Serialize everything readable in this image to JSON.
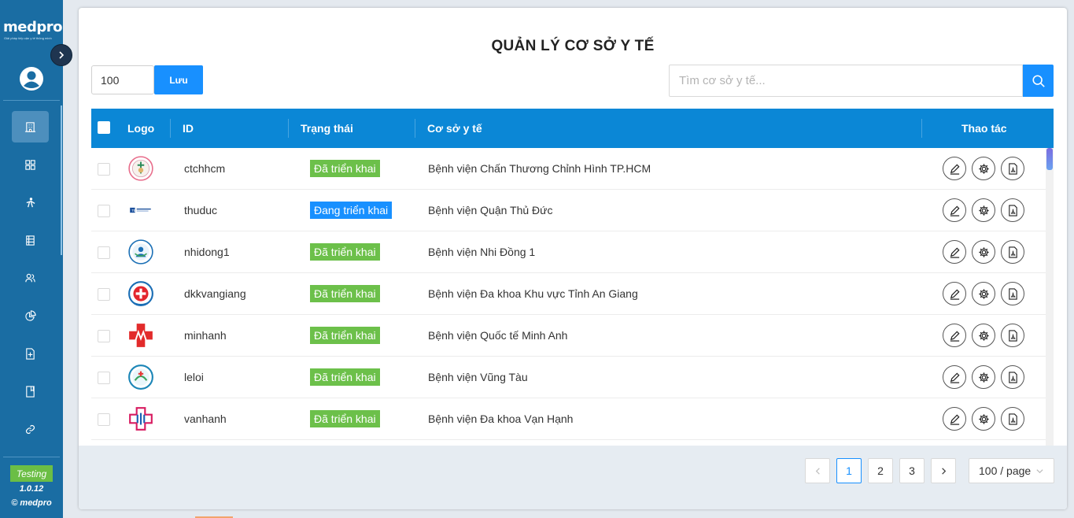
{
  "app": {
    "brand": "medpro",
    "tagline": "Giải pháp tiếp cận y tế thông minh",
    "env_badge": "Testing",
    "version": "1.0.12",
    "copyright": "© medpro"
  },
  "sidebar": {
    "items": [
      {
        "name": "building-icon",
        "active": true
      },
      {
        "name": "grid-icon",
        "active": false
      },
      {
        "name": "hierarchy-icon",
        "active": false
      },
      {
        "name": "list-icon",
        "active": false
      },
      {
        "name": "users-icon",
        "active": false
      },
      {
        "name": "pie-chart-icon",
        "active": false
      },
      {
        "name": "file-add-icon",
        "active": false
      },
      {
        "name": "book-icon",
        "active": false
      },
      {
        "name": "link-icon",
        "active": false
      }
    ]
  },
  "page": {
    "title": "QUẢN LÝ CƠ SỞ Y TẾ",
    "limit_value": "100",
    "save_label": "Lưu",
    "search_placeholder": "Tìm cơ sở y tế..."
  },
  "table": {
    "headers": {
      "logo": "Logo",
      "id": "ID",
      "status": "Trạng thái",
      "facility": "Cơ sở y tế",
      "actions": "Thao tác"
    },
    "rows": [
      {
        "id": "ctchhcm",
        "status": "Đã triển khai",
        "status_type": "deployed",
        "facility": "Bệnh viện Chấn Thương Chỉnh Hình TP.HCM",
        "logo": "ctchhcm"
      },
      {
        "id": "thuduc",
        "status": "Đang triển khai",
        "status_type": "deploying",
        "facility": "Bệnh viện Quận Thủ Đức",
        "logo": "thuduc"
      },
      {
        "id": "nhidong1",
        "status": "Đã triển khai",
        "status_type": "deployed",
        "facility": "Bệnh viện Nhi Đồng 1",
        "logo": "nhidong1"
      },
      {
        "id": "dkkvangiang",
        "status": "Đã triển khai",
        "status_type": "deployed",
        "facility": "Bệnh viện Đa khoa Khu vực Tỉnh An Giang",
        "logo": "dkkvangiang"
      },
      {
        "id": "minhanh",
        "status": "Đã triển khai",
        "status_type": "deployed",
        "facility": "Bệnh viện Quốc tế Minh Anh",
        "logo": "minhanh"
      },
      {
        "id": "leloi",
        "status": "Đã triển khai",
        "status_type": "deployed",
        "facility": "Bệnh viện Vũng Tàu",
        "logo": "leloi"
      },
      {
        "id": "vanhanh",
        "status": "Đã triển khai",
        "status_type": "deployed",
        "facility": "Bệnh viện Đa khoa Vạn Hạnh",
        "logo": "vanhanh"
      }
    ]
  },
  "pagination": {
    "pages": [
      "1",
      "2",
      "3"
    ],
    "current": "1",
    "page_size": "100 / page"
  },
  "colors": {
    "sidebar": "#1a6da3",
    "header": "#0b87d6",
    "primary": "#1890ff",
    "deployed": "#6cc04a",
    "deploying": "#1890ff",
    "testing": "#6bbe45"
  }
}
